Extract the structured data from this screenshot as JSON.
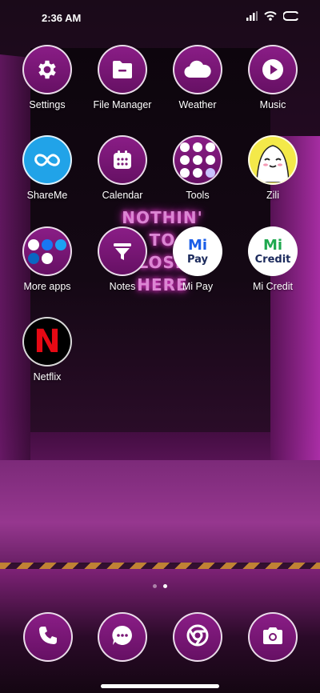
{
  "status_bar": {
    "time": "2:36 AM",
    "icons": [
      "signal-icon",
      "wifi-icon",
      "battery-icon"
    ]
  },
  "apps": [
    {
      "label": "Settings",
      "icon": "gear-icon"
    },
    {
      "label": "File Manager",
      "icon": "folder-icon"
    },
    {
      "label": "Weather",
      "icon": "cloud-icon"
    },
    {
      "label": "Music",
      "icon": "play-icon"
    },
    {
      "label": "ShareMe",
      "icon": "infinity-icon"
    },
    {
      "label": "Calendar",
      "icon": "calendar-icon"
    },
    {
      "label": "Tools",
      "icon": "tools-folder-icon"
    },
    {
      "label": "Zili",
      "icon": "zili-face-icon"
    },
    {
      "label": "More apps",
      "icon": "more-apps-folder-icon"
    },
    {
      "label": "Notes",
      "icon": "funnel-icon"
    },
    {
      "label": "Mi Pay",
      "icon": "mi-pay-logo",
      "logo_top": "Mi",
      "logo_bottom": "Pay"
    },
    {
      "label": "Mi Credit",
      "icon": "mi-credit-logo",
      "logo_top": "Mi",
      "logo_bottom": "Credit"
    },
    {
      "label": "Netflix",
      "icon": "netflix-logo",
      "logo_text": "N"
    }
  ],
  "pager": {
    "pages": 2,
    "active_page": 2
  },
  "dock": [
    {
      "icon": "phone-icon"
    },
    {
      "icon": "messages-icon"
    },
    {
      "icon": "chrome-icon"
    },
    {
      "icon": "camera-icon"
    }
  ],
  "wallpaper": {
    "neon_text": "NOTHIN' TO\nLOSE HERE"
  },
  "colors": {
    "icon_fill": "#7a1776",
    "icon_border": "#ffffff",
    "shareme_blue": "#21a3e8",
    "zili_yellow": "#f4e94a",
    "netflix_red": "#e50914",
    "mi_blue": "#1b5ee8",
    "mi_green": "#1fa84f"
  }
}
